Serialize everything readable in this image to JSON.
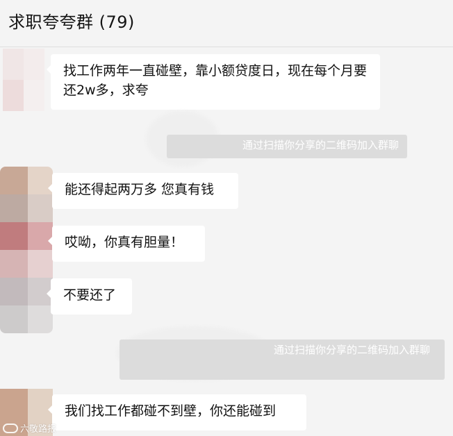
{
  "chat": {
    "title": "求职夸夸群 (79)"
  },
  "messages": [
    {
      "text": "找工作两年一直碰壁，靠小额贷度日，现在每个月要还2w多，求夸"
    },
    {
      "text": "能还得起两万多 您真有钱"
    },
    {
      "text": "哎呦，你真有胆量！"
    },
    {
      "text": "不要还了"
    },
    {
      "text": "我们找工作都碰不到壁，你还能碰到"
    }
  ],
  "system_notices": [
    {
      "text": "通过扫描你分享的二维码加入群聊"
    },
    {
      "text": "通过扫描你分享的二维码加入群聊"
    }
  ],
  "watermark": {
    "text": "六敬路报"
  },
  "colors": {
    "background": "#f4f4f4",
    "bubble": "#ffffff",
    "system_notice": "#dcdcdc"
  },
  "icons": [
    "avatar-blurred"
  ]
}
